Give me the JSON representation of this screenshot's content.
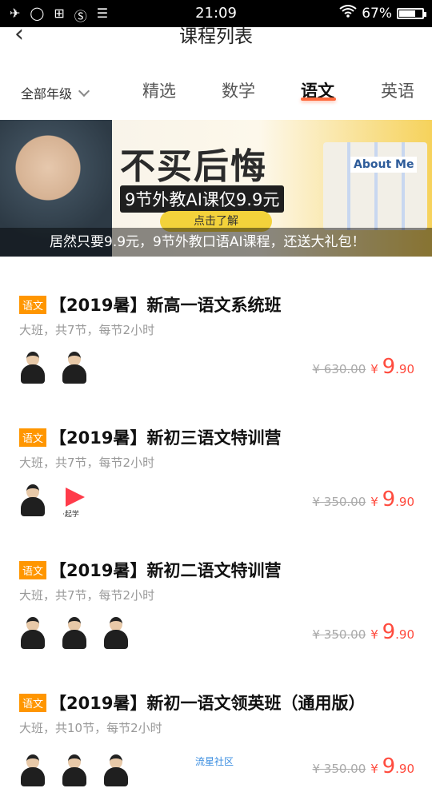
{
  "status_bar": {
    "time": "21:09",
    "battery": "67%"
  },
  "header": {
    "title": "课程列表"
  },
  "tabs": {
    "grade_select": "全部年级",
    "items": [
      "精选",
      "数学",
      "语文",
      "英语"
    ],
    "active": "语文"
  },
  "banner": {
    "headline": "不买后悔",
    "subline": "9节外教AI课仅9.9元",
    "cta": "点击了解",
    "book_label": "About Me",
    "caption": "居然只要9.9元，9节外教口语AI课程，还送大礼包！"
  },
  "courses": [
    {
      "tag": "语文",
      "title": "【2019暑】新高一语文系统班",
      "meta": "大班，共7节，每节2小时",
      "original_price": "¥ 630.00",
      "currency": "¥",
      "price_int": "9",
      "price_dec": ".90"
    },
    {
      "tag": "语文",
      "title": "【2019暑】新初三语文特训营",
      "meta": "大班，共7节，每节2小时",
      "original_price": "¥ 350.00",
      "currency": "¥",
      "price_int": "9",
      "price_dec": ".90",
      "logo_text": "·起学"
    },
    {
      "tag": "语文",
      "title": "【2019暑】新初二语文特训营",
      "meta": "大班，共7节，每节2小时",
      "original_price": "¥ 350.00",
      "currency": "¥",
      "price_int": "9",
      "price_dec": ".90"
    },
    {
      "tag": "语文",
      "title": "【2019暑】新初一语文领英班（通用版）",
      "meta": "大班，共10节，每节2小时",
      "original_price": "¥ 350.00",
      "currency": "¥",
      "price_int": "9",
      "price_dec": ".90"
    }
  ],
  "watermark": "流星社区",
  "colors": {
    "accent": "#ff6a3d",
    "tag": "#ff9600",
    "price": "#ff4b3e"
  }
}
